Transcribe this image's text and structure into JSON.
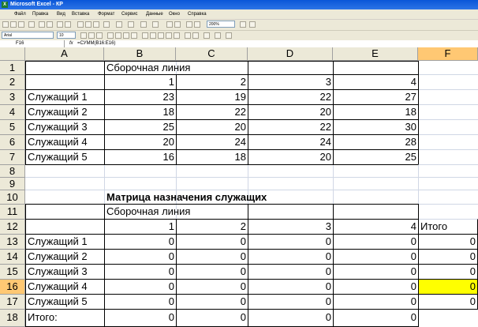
{
  "window": {
    "title": "Microsoft Excel - КР"
  },
  "menu": [
    "Файл",
    "Правка",
    "Вид",
    "Вставка",
    "Формат",
    "Сервис",
    "Данные",
    "Окно",
    "Справка"
  ],
  "toolbar": {
    "zoom": "200%",
    "font": "Arial",
    "font_size": "10"
  },
  "formula_bar": {
    "name_box": "F16",
    "fx": "fx",
    "formula": "=СУММ(B16:E16)"
  },
  "columns": [
    "A",
    "B",
    "C",
    "D",
    "E",
    "F"
  ],
  "rows": [
    "1",
    "2",
    "3",
    "4",
    "5",
    "6",
    "7",
    "8",
    "9",
    "10",
    "11",
    "12",
    "13",
    "14",
    "15",
    "16",
    "17",
    "18"
  ],
  "active_cell": "F16",
  "table1": {
    "header": "Сборочная линия",
    "line_numbers": [
      "1",
      "2",
      "3",
      "4"
    ],
    "rows": [
      {
        "label": "Служащий 1",
        "values": [
          "23",
          "19",
          "22",
          "27"
        ]
      },
      {
        "label": "Служащий 2",
        "values": [
          "18",
          "22",
          "20",
          "18"
        ]
      },
      {
        "label": "Служащий 3",
        "values": [
          "25",
          "20",
          "22",
          "30"
        ]
      },
      {
        "label": "Служащий 4",
        "values": [
          "20",
          "24",
          "24",
          "28"
        ]
      },
      {
        "label": "Служащий 5",
        "values": [
          "16",
          "18",
          "20",
          "25"
        ]
      }
    ]
  },
  "table2": {
    "title": "Матрица назначения служащих",
    "header": "Сборочная линия",
    "line_numbers": [
      "1",
      "2",
      "3",
      "4"
    ],
    "total_header": "Итого",
    "rows": [
      {
        "label": "Служащий 1",
        "values": [
          "0",
          "0",
          "0",
          "0"
        ],
        "total": "0"
      },
      {
        "label": "Служащий 2",
        "values": [
          "0",
          "0",
          "0",
          "0"
        ],
        "total": "0"
      },
      {
        "label": "Служащий 3",
        "values": [
          "0",
          "0",
          "0",
          "0"
        ],
        "total": "0"
      },
      {
        "label": "Служащий 4",
        "values": [
          "0",
          "0",
          "0",
          "0"
        ],
        "total": "0"
      },
      {
        "label": "Служащий 5",
        "values": [
          "0",
          "0",
          "0",
          "0"
        ],
        "total": "0"
      }
    ],
    "totals_label": "Итого:",
    "totals": [
      "0",
      "0",
      "0",
      "0"
    ]
  },
  "colors": {
    "active_cell_fill": "#ffff00",
    "header_fill": "#ece9d8",
    "active_header_fill": "#ffc873",
    "title_bar": "#0a56d8"
  }
}
